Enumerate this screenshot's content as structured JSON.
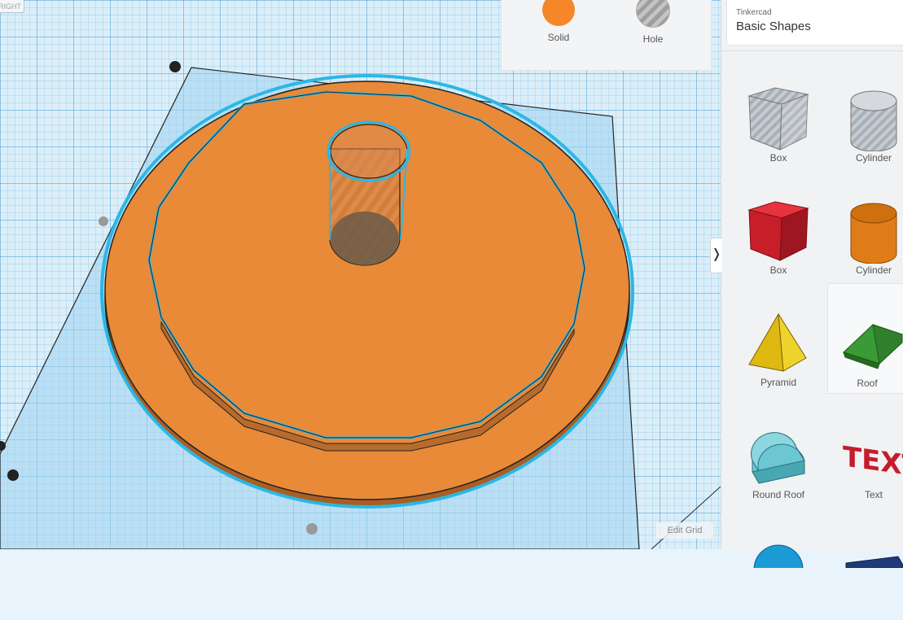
{
  "viewport": {
    "view_cube_label": "RIGHT"
  },
  "inspector": {
    "modes": [
      {
        "label": "Solid",
        "color": "#f5862a"
      },
      {
        "label": "Hole",
        "color": "#b7b7b7"
      }
    ]
  },
  "library": {
    "brand": "Tinkercad",
    "category": "Basic Shapes",
    "shapes": [
      {
        "label": "Box",
        "icon": "box-hole-icon"
      },
      {
        "label": "Cylinder",
        "icon": "cylinder-hole-icon"
      },
      {
        "label": "Box",
        "icon": "box-solid-icon",
        "color": "#d1202f"
      },
      {
        "label": "Cylinder",
        "icon": "cylinder-solid-icon",
        "color": "#e8801b"
      },
      {
        "label": "Pyramid",
        "icon": "pyramid-icon",
        "color": "#e8c316"
      },
      {
        "label": "Roof",
        "icon": "roof-icon",
        "color": "#3fa43b"
      },
      {
        "label": "Round Roof",
        "icon": "round-roof-icon",
        "color": "#5bbcc9"
      },
      {
        "label": "Text",
        "icon": "text-shape-icon",
        "color": "#d1202f",
        "shape_text": "TEXT"
      },
      {
        "label": "",
        "icon": "sphere-icon",
        "color": "#1b9ad6"
      },
      {
        "label": "",
        "icon": "shape-icon",
        "color": "#1f3a78"
      }
    ],
    "collapse_glyph": "❭"
  },
  "edit_grid_label": "Edit Grid",
  "colors": {
    "accent_selection": "#2bb7e6",
    "object_orange": "#e88a38"
  }
}
